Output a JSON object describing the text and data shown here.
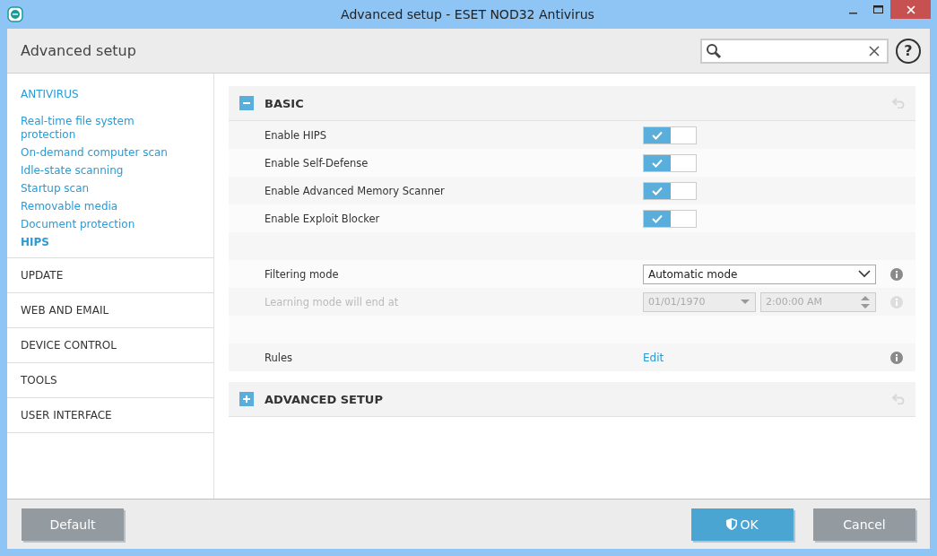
{
  "window": {
    "title": "Advanced setup - ESET NOD32 Antivirus"
  },
  "header": {
    "title": "Advanced setup",
    "help": "?"
  },
  "sidebar": {
    "items": [
      {
        "label": "ANTIVIRUS",
        "selected": false,
        "children": [
          {
            "label": "Real-time file system protection",
            "selected": false
          },
          {
            "label": "On-demand computer scan",
            "selected": false
          },
          {
            "label": "Idle-state scanning",
            "selected": false
          },
          {
            "label": "Startup scan",
            "selected": false
          },
          {
            "label": "Removable media",
            "selected": false
          },
          {
            "label": "Document protection",
            "selected": false
          },
          {
            "label": "HIPS",
            "selected": true
          }
        ]
      },
      {
        "label": "UPDATE",
        "selected": false
      },
      {
        "label": "WEB AND EMAIL",
        "selected": false
      },
      {
        "label": "DEVICE CONTROL",
        "selected": false
      },
      {
        "label": "TOOLS",
        "selected": false
      },
      {
        "label": "USER INTERFACE",
        "selected": false
      }
    ]
  },
  "sections": [
    {
      "title": "BASIC",
      "expanded": true,
      "rows": [
        {
          "kind": "toggle",
          "label": "Enable HIPS",
          "on": true
        },
        {
          "kind": "toggle",
          "label": "Enable Self-Defense",
          "on": true
        },
        {
          "kind": "toggle",
          "label": "Enable Advanced Memory Scanner",
          "on": true
        },
        {
          "kind": "toggle",
          "label": "Enable Exploit Blocker",
          "on": true
        },
        {
          "kind": "spacer"
        },
        {
          "kind": "select",
          "label": "Filtering mode",
          "value": "Automatic mode",
          "disabled": false
        },
        {
          "kind": "datetime",
          "label": "Learning mode will end at",
          "date": "01/01/1970",
          "time": "2:00:00 AM",
          "disabled": true
        },
        {
          "kind": "spacer"
        },
        {
          "kind": "link",
          "label": "Rules",
          "link": "Edit"
        }
      ]
    },
    {
      "title": "ADVANCED SETUP",
      "expanded": false
    }
  ],
  "footer": {
    "buttons": [
      {
        "label": "Default",
        "kind": "secondary"
      },
      {
        "label": "OK",
        "kind": "primary"
      },
      {
        "label": "Cancel",
        "kind": "secondary"
      }
    ]
  }
}
